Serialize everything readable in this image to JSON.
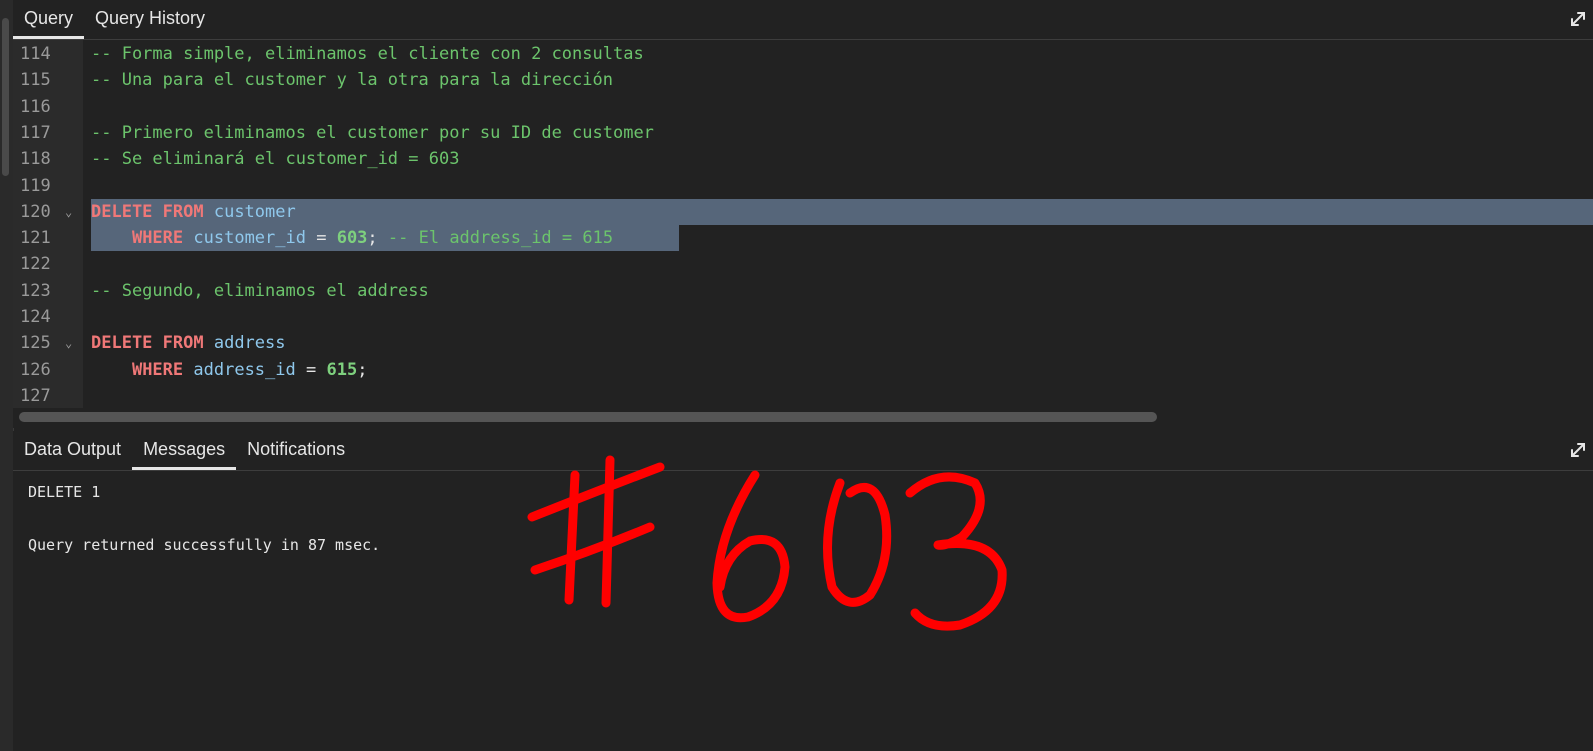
{
  "query_tabs": [
    {
      "label": "Query",
      "active": true
    },
    {
      "label": "Query History",
      "active": false
    }
  ],
  "editor": {
    "lines": [
      {
        "num": "114",
        "segments": [
          {
            "t": "cm",
            "v": "-- Forma simple, eliminamos el cliente con 2 consultas"
          }
        ]
      },
      {
        "num": "115",
        "segments": [
          {
            "t": "cm",
            "v": "-- Una para el customer y la otra para la dirección"
          }
        ]
      },
      {
        "num": "116",
        "segments": []
      },
      {
        "num": "117",
        "segments": [
          {
            "t": "cm",
            "v": "-- Primero eliminamos el customer por su ID de customer"
          }
        ]
      },
      {
        "num": "118",
        "segments": [
          {
            "t": "cm",
            "v": "-- Se eliminará el customer_id = 603"
          }
        ]
      },
      {
        "num": "119",
        "segments": []
      },
      {
        "num": "120",
        "fold": true,
        "selection": "full",
        "segments": [
          {
            "t": "kw",
            "v": "DELETE FROM"
          },
          {
            "t": "pn",
            "v": " "
          },
          {
            "t": "id",
            "v": "customer"
          }
        ]
      },
      {
        "num": "121",
        "selection": "partial",
        "segments": [
          {
            "t": "pn",
            "v": "    "
          },
          {
            "t": "kw",
            "v": "WHERE"
          },
          {
            "t": "pn",
            "v": " "
          },
          {
            "t": "id",
            "v": "customer_id"
          },
          {
            "t": "pn",
            "v": " = "
          },
          {
            "t": "num",
            "v": "603"
          },
          {
            "t": "pn",
            "v": "; "
          },
          {
            "t": "cm",
            "v": "-- El address_id = 615"
          }
        ]
      },
      {
        "num": "122",
        "segments": []
      },
      {
        "num": "123",
        "segments": [
          {
            "t": "cm",
            "v": "-- Segundo, eliminamos el address"
          }
        ]
      },
      {
        "num": "124",
        "segments": []
      },
      {
        "num": "125",
        "fold": true,
        "segments": [
          {
            "t": "kw",
            "v": "DELETE FROM"
          },
          {
            "t": "pn",
            "v": " "
          },
          {
            "t": "id",
            "v": "address"
          }
        ]
      },
      {
        "num": "126",
        "segments": [
          {
            "t": "pn",
            "v": "    "
          },
          {
            "t": "kw",
            "v": "WHERE"
          },
          {
            "t": "pn",
            "v": " "
          },
          {
            "t": "id",
            "v": "address_id"
          },
          {
            "t": "pn",
            "v": " = "
          },
          {
            "t": "num",
            "v": "615"
          },
          {
            "t": "pn",
            "v": ";"
          }
        ]
      },
      {
        "num": "127",
        "segments": []
      }
    ]
  },
  "output_tabs": [
    {
      "label": "Data Output",
      "active": false
    },
    {
      "label": "Messages",
      "active": true
    },
    {
      "label": "Notifications",
      "active": false
    }
  ],
  "messages": {
    "line1": "DELETE 1",
    "line2": "Query returned successfully in 87 msec."
  },
  "annotation": {
    "text": "#603",
    "color": "#ff0000"
  },
  "colors": {
    "background": "#222222",
    "selection": "#56667a",
    "comment": "#6cc46c",
    "keyword": "#f07878",
    "identifier": "#8fc8ec",
    "number": "#7ed07e"
  },
  "icons": {
    "expand": "expand-arrows-icon",
    "fold": "chevron-down-icon"
  }
}
